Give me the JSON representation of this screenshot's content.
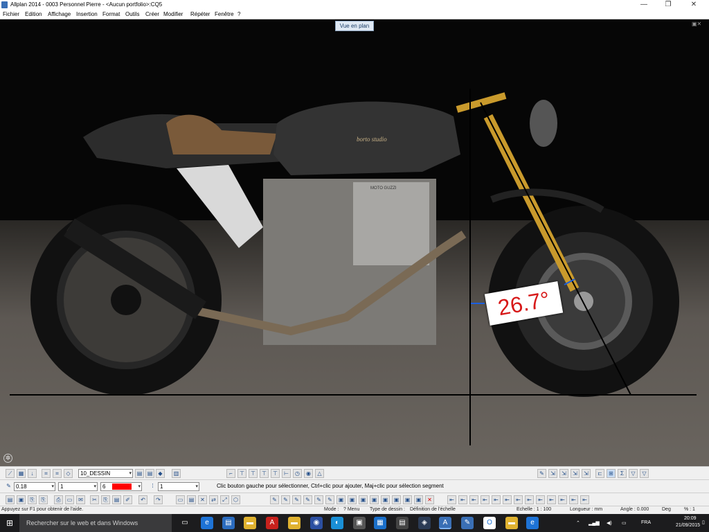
{
  "window": {
    "title": "Allplan 2014 - 0003 Personnel Pierre - <Aucun portfolio>:CQ5",
    "minimize_glyph": "—",
    "maximize_glyph": "❐",
    "close_glyph": "✕"
  },
  "menu": {
    "items": [
      "Fichier",
      "Edition",
      "Affichage",
      "Insertion",
      "Format",
      "Outils",
      "Créer",
      "Modifier",
      "Répéter",
      "Fenêtre",
      "?"
    ]
  },
  "viewport": {
    "view_label": "Vue en plan",
    "angle_annotation": "26.7°",
    "tank_branding": "borto studio",
    "engine_label": "MOTO GUZZI"
  },
  "toolbar1": {
    "layer_value": "10_DESSIN"
  },
  "toolbar2": {
    "pen_value": "0.18",
    "line_value": "1",
    "color_value": "6",
    "color_hex": "#ff0000",
    "pattern_value": "1",
    "hint": "Clic bouton gauche pour sélectionner, Ctrl+clic pour ajouter, Maj+clic pour sélection segment"
  },
  "statusbar": {
    "help": "Appuyez sur F1 pour obtenir de l'aide.",
    "mode": "Mode :",
    "mode_value": "? Menu",
    "drawing_type": "Type de dessin :",
    "drawing_type_value": "Définition de l'échelle",
    "scale": "Echelle : 1 : 100",
    "length": "Longueur : mm",
    "angle": "Angle : 0.000",
    "angle_unit": "Deg",
    "percent": "% : 1"
  },
  "taskbar": {
    "search_placeholder": "Rechercher sur le web et dans Windows",
    "language": "FRA",
    "time": "20:09",
    "date": "21/09/2015"
  },
  "colors": {
    "accent": "#3a6fb5",
    "annotation_red": "#d71919",
    "dimension_blue": "#1a5fe0"
  }
}
